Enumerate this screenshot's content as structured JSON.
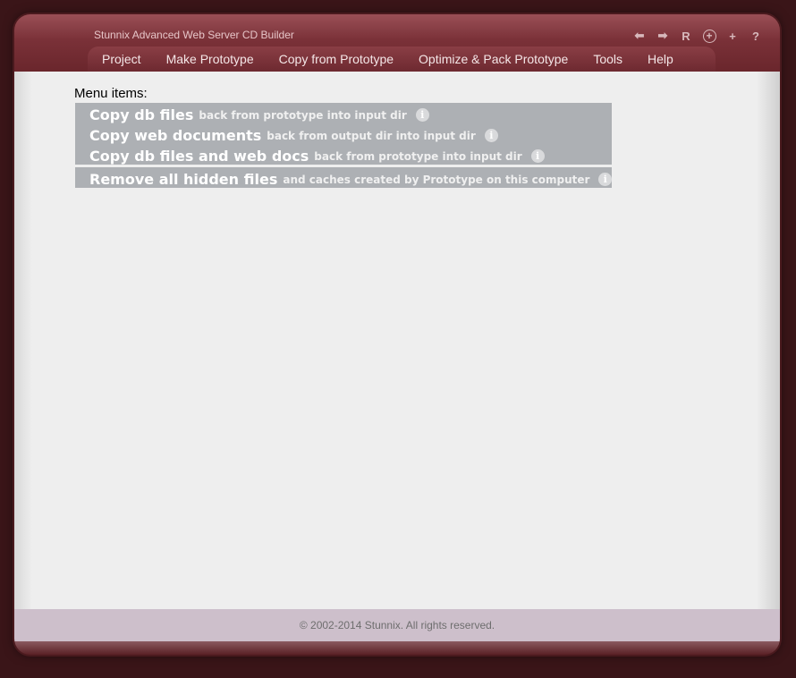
{
  "app": {
    "title": "Stunnix Advanced Web Server CD Builder"
  },
  "title_icons": [
    {
      "name": "back-arrow-icon",
      "glyph": "⬅"
    },
    {
      "name": "forward-arrow-icon",
      "glyph": "➡"
    },
    {
      "name": "reload-icon",
      "glyph": "R"
    },
    {
      "name": "add-circle-icon",
      "glyph": "+"
    },
    {
      "name": "plus-icon",
      "glyph": "+"
    },
    {
      "name": "help-icon",
      "glyph": "?"
    }
  ],
  "menubar": {
    "items": [
      "Project",
      "Make Prototype",
      "Copy from Prototype",
      "Optimize & Pack Prototype",
      "Tools",
      "Help"
    ]
  },
  "content": {
    "heading": "Menu items:",
    "entries": [
      {
        "title": "Copy db files",
        "desc": "back from prototype into input dir"
      },
      {
        "title": "Copy web documents",
        "desc": "back from output dir into input dir"
      },
      {
        "title": "Copy db files and web docs",
        "desc": "back from prototype into input dir"
      },
      {
        "title": "Remove all hidden files",
        "desc": "and caches created by Prototype on this computer"
      }
    ],
    "info_glyph": "i"
  },
  "footer": {
    "text": "© 2002-2014 Stunnix. All rights reserved."
  },
  "colors": {
    "titlebar": "#7a3138",
    "background": "#3a1518",
    "content": "#eeeeee",
    "menu_block": "#adb0b4",
    "footer": "#cdbfcb"
  }
}
